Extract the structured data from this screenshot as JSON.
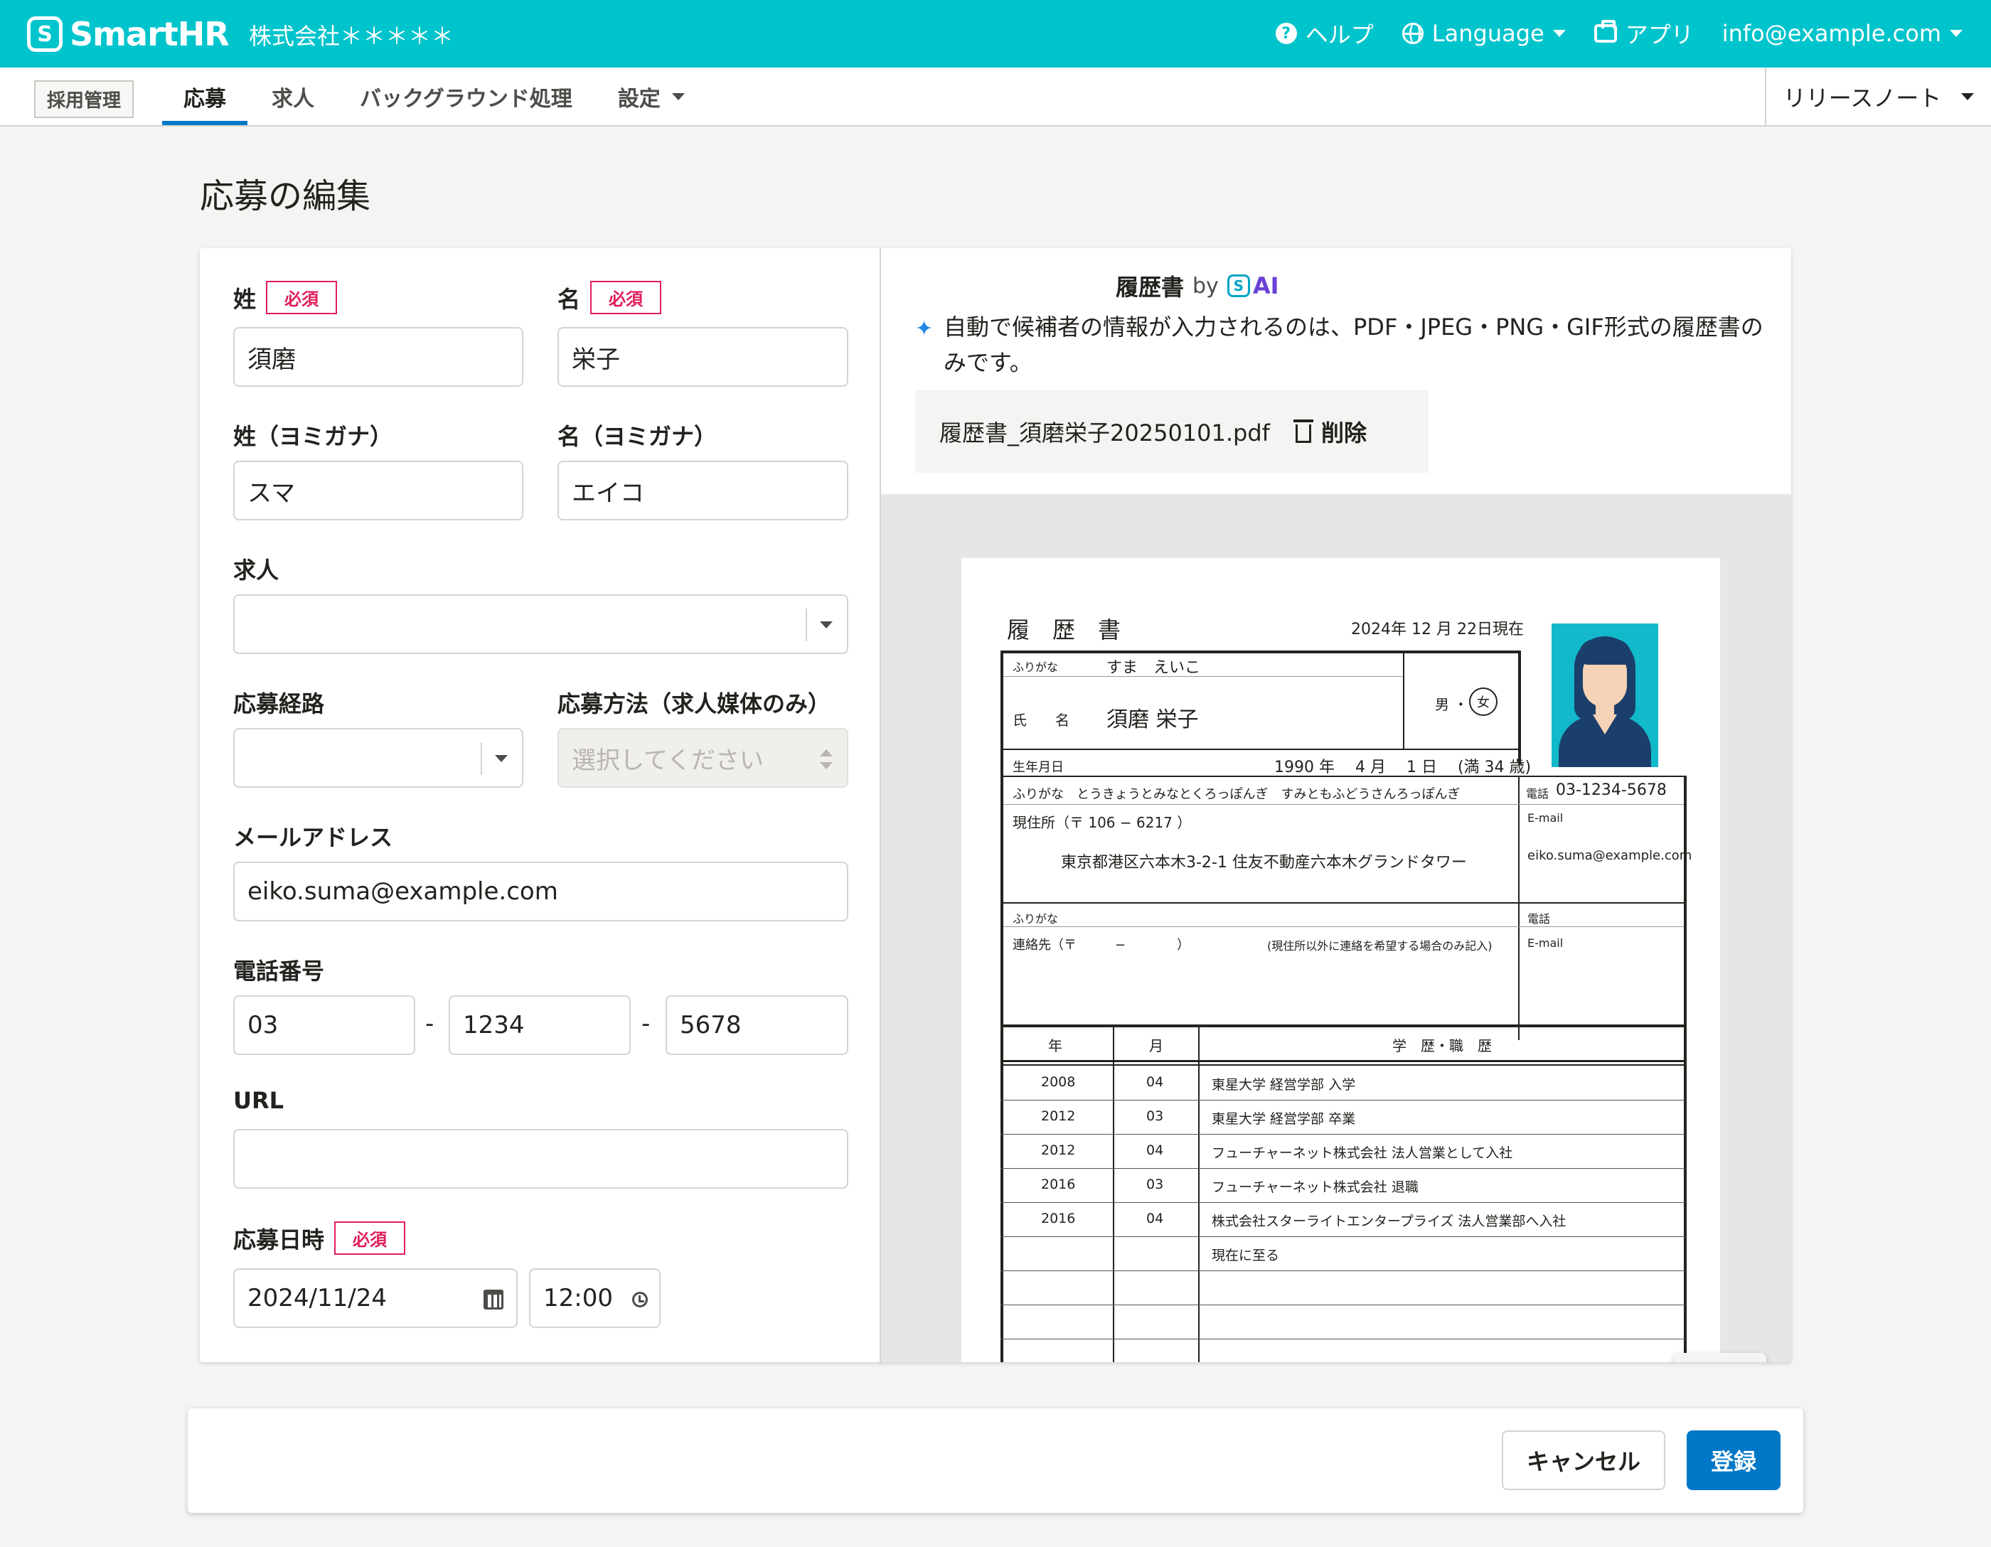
{
  "header": {
    "logo_mark": "S",
    "logo_text": "SmartHR",
    "tenant": "株式会社＊＊＊＊＊",
    "help_label": "ヘルプ",
    "language_label": "Language",
    "apps_label": "アプリ",
    "account_email": "info@example.com",
    "brand_color": "#00c4cc"
  },
  "subnav": {
    "app_badge": "採用管理",
    "tabs": [
      {
        "label": "応募"
      },
      {
        "label": "求人"
      },
      {
        "label": "バックグラウンド処理"
      },
      {
        "label": "設定"
      }
    ],
    "active_tab": "応募",
    "release_notes": "リリースノート"
  },
  "page": {
    "title": "応募の編集"
  },
  "form": {
    "required_badge": "必須",
    "last_name_label": "姓",
    "last_name_value": "須磨",
    "first_name_label": "名",
    "first_name_value": "栄子",
    "last_kana_label": "姓（ヨミガナ）",
    "last_kana_value": "スマ",
    "first_kana_label": "名（ヨミガナ）",
    "first_kana_value": "エイコ",
    "job_label": "求人",
    "job_value": "",
    "route_label": "応募経路",
    "route_value": "",
    "method_label": "応募方法（求人媒体のみ）",
    "method_placeholder": "選択してください",
    "email_label": "メールアドレス",
    "email_value": "eiko.suma@example.com",
    "phone_label": "電話番号",
    "phone_1": "03",
    "phone_2": "1234",
    "phone_3": "5678",
    "phone_sep": "-",
    "url_label": "URL",
    "url_value": "",
    "applied_label": "応募日時",
    "applied_date": "2024/11/24",
    "applied_time": "12:00"
  },
  "resume_panel": {
    "title": "履歴書",
    "by": "by",
    "ai_mark": "S",
    "ai_text": "AI",
    "note": "自動で候補者の情報が入力されるのは、PDF・JPEG・PNG・GIF形式の履歴書のみです。",
    "file_name": "履歴書_須磨栄子20250101.pdf",
    "delete_label": "削除"
  },
  "resume_doc": {
    "title": "履　歴　書",
    "date": "2024年 12 月  22日現在",
    "furigana_label": "ふりがな",
    "furigana_value": "すま　えいこ",
    "name_label": "氏　　名",
    "name_value": "須磨 栄子",
    "gender": "男 ・",
    "gender_selected": "女",
    "birth_label": "生年月日",
    "birth_value": "1990  年　 4 月　 1  日　 (満 34 歳)",
    "addr_furigana": "ふりがな　とうきょうとみなとくろっぽんぎ　すみともふどうさんろっぽんぎ",
    "tel_label": "電話",
    "tel_value": "03-1234-5678",
    "addr_label": "現住所（〒 106 − 6217 ）",
    "email_label": "E-mail",
    "addr_value": "東京都港区六本木3-2-1 住友不動産六本木グランドタワー",
    "email_value": "eiko.suma@example.com",
    "contact_furigana": "ふりがな",
    "contact_tel": "電話",
    "contact_label": "連絡先（〒　　　−　　　　）",
    "contact_note": "(現住所以外に連絡を希望する場合のみ記入)",
    "contact_email": "E-mail",
    "history_headers": [
      "年",
      "月",
      "学　歴・職　歴"
    ],
    "history": [
      {
        "year": "2008",
        "month": "04",
        "text": "東星大学 経営学部 入学"
      },
      {
        "year": "2012",
        "month": "03",
        "text": "東星大学 経営学部 卒業"
      },
      {
        "year": "2012",
        "month": "04",
        "text": "フューチャーネット株式会社 法人営業として入社"
      },
      {
        "year": "2016",
        "month": "03",
        "text": "フューチャーネット株式会社 退職"
      },
      {
        "year": "2016",
        "month": "04",
        "text": "株式会社スターライトエンタープライズ 法人営業部へ入社"
      },
      {
        "year": "",
        "month": "",
        "text": "現在に至る"
      }
    ]
  },
  "viewer_tools": [
    {
      "name": "rotate-icon",
      "glyph": "↺"
    },
    {
      "name": "zoom-in-icon",
      "glyph": "⊕"
    },
    {
      "name": "zoom-out-icon",
      "glyph": "⊖"
    }
  ],
  "actions": {
    "cancel": "キャンセル",
    "submit": "登録",
    "primary_color": "#0077c7"
  }
}
